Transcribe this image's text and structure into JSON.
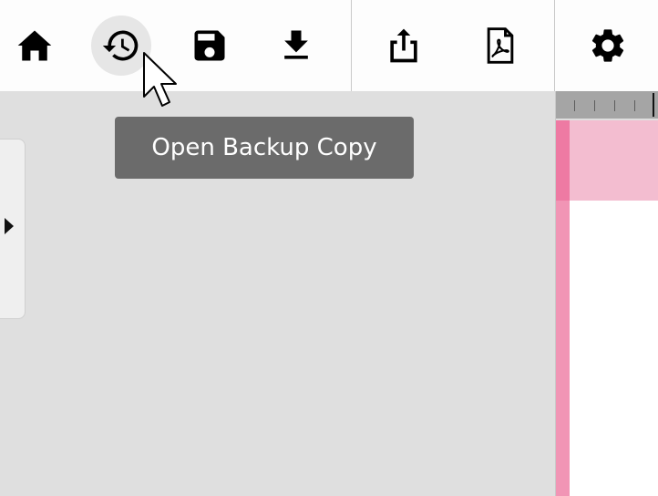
{
  "toolbar": {
    "buttons": [
      {
        "name": "home",
        "icon": "home-icon"
      },
      {
        "name": "open-backup-copy",
        "icon": "history-icon",
        "active": true
      },
      {
        "name": "save",
        "icon": "save-icon"
      },
      {
        "name": "download",
        "icon": "download-icon"
      },
      {
        "name": "share",
        "icon": "share-icon"
      },
      {
        "name": "export-pdf",
        "icon": "pdf-icon"
      },
      {
        "name": "settings",
        "icon": "gear-icon"
      }
    ]
  },
  "tooltip": {
    "text": "Open Backup Copy"
  },
  "side_panel": {
    "toggle_icon": "caret-right-icon"
  },
  "colors": {
    "toolbar_bg": "#fdfdfd",
    "canvas_bg": "#dfdfdf",
    "tooltip_bg": "#6b6b6b",
    "ruler_bg": "#a5a5a5",
    "page_header_pink": "#f3bdd0",
    "page_margin_pink": "#f195b5"
  }
}
